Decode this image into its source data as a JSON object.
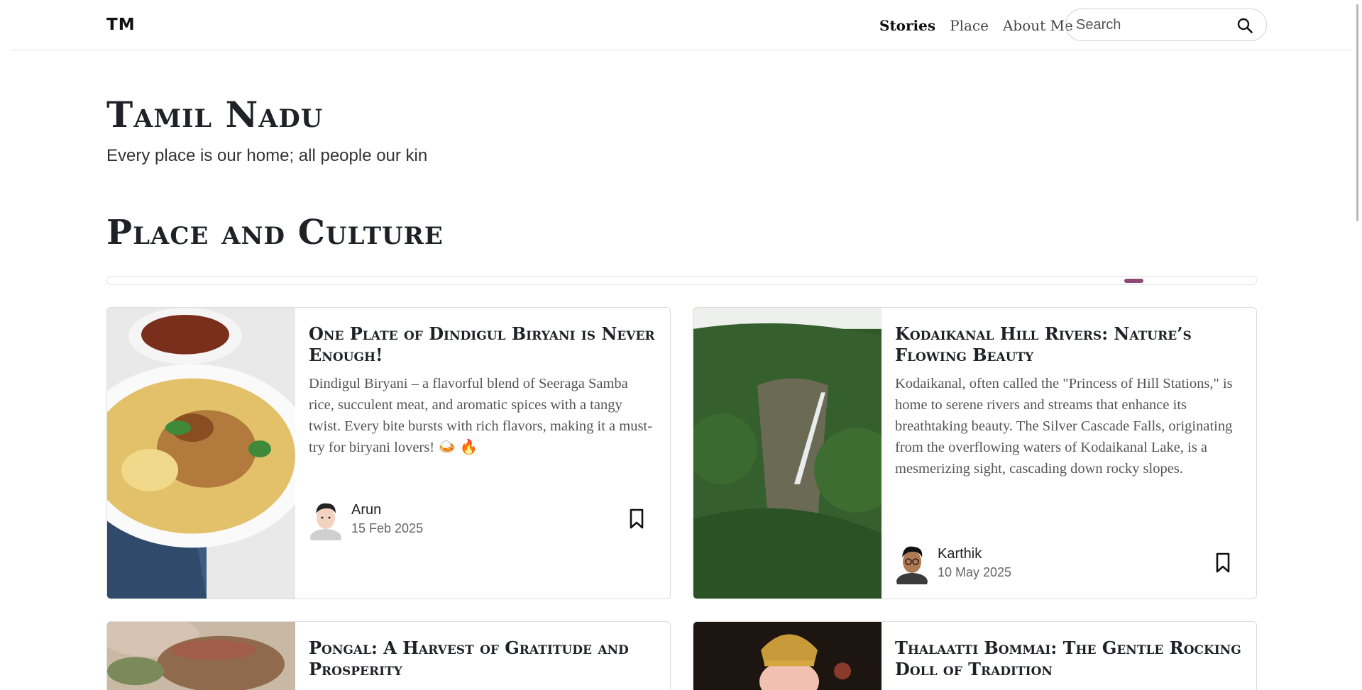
{
  "header": {
    "logo": "TM",
    "nav": [
      {
        "label": "Stories",
        "active": true
      },
      {
        "label": "Place",
        "active": false
      },
      {
        "label": "About Me",
        "active": false
      }
    ],
    "search": {
      "placeholder": "Search",
      "icon": "search-icon"
    }
  },
  "hero": {
    "title": "Tamil Nadu",
    "subtitle": "Every place is our home; all people our kin"
  },
  "section": {
    "title": "Place and Culture",
    "progress_fraction": 0.9
  },
  "cards": [
    {
      "title": "One Plate of Dindigul Biryani is Never Enough!",
      "text": "Dindigul Biryani – a flavorful blend of Seeraga Samba rice, succulent meat, and aromatic spices with a tangy twist. Every bite bursts with rich flavors, making it a must-try for biryani lovers! 🍛 🔥",
      "author": "Arun",
      "date": "15 Feb 2025",
      "image": "biryani-plate",
      "bookmark_icon": "bookmark-icon"
    },
    {
      "title": "Kodaikanal Hill Rivers: Nature’s Flowing Beauty",
      "text": "Kodaikanal, often called the \"Princess of Hill Stations,\" is home to serene rivers and streams that enhance its breathtaking beauty. The Silver Cascade Falls, originating from the overflowing waters of Kodaikanal Lake, is a mesmerizing sight, cascading down rocky slopes.",
      "author": "Karthik",
      "date": "10 May 2025",
      "image": "waterfall-valley",
      "bookmark_icon": "bookmark-icon"
    },
    {
      "title": "Pongal: A Harvest of Gratitude and Prosperity",
      "image": "pongal-pot"
    },
    {
      "title": "Thalaatti Bommai: The Gentle Rocking Doll of Tradition",
      "image": "thalaatti-doll"
    }
  ],
  "colors": {
    "accent": "#8e4a74",
    "heading": "#1e2126",
    "border": "#dcdcdc"
  }
}
